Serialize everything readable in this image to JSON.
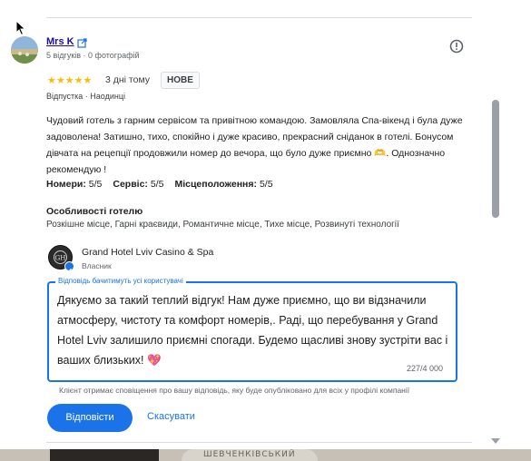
{
  "reviewer": {
    "name": "Mrs K",
    "meta": "5 відгуків · 0 фотографій"
  },
  "review": {
    "stars": "★★★★★",
    "time_ago": "3 дні тому",
    "badge": "НОВЕ",
    "trip": "Відпустка · Наодинці",
    "text": "Чудовий готель з гарним сервісом та привітною командою. Замовляла Спа-вікенд і була дуже задоволена! Затишно, тихо, спокійно і дуже красиво, прекрасний сніданок в готелі. Бонусом дівчата на рецепції продовжили номер до вечора, що було дуже приємно 🫶. Однозначно рекомендую !",
    "ratings": {
      "rooms_label": "Номери:",
      "rooms_value": "5/5",
      "service_label": "Сервіс:",
      "service_value": "5/5",
      "location_label": "Місцеположення:",
      "location_value": "5/5"
    },
    "features_title": "Особливості готелю",
    "features": "Розкішне місце, Гарні краєвиди, Романтичне місце, Тихе місце, Розвинуті технології"
  },
  "owner": {
    "name": "Grand Hotel Lviv Casino & Spa",
    "role": "Власник"
  },
  "reply": {
    "legend": "Відповідь бачитимуть усі користувачі",
    "text": "Дякуємо за такий теплий відгук! Нам дуже приємно, що ви відзначили атмосферу, чистоту та комфорт номерів,. Раді, що перебування у Grand Hotel Lviv залишило приємні спогади. Будемо щасливі знову зустріти вас і ваших близьких! 💖",
    "char_count": "227/4 000",
    "notice": "Клієнт отримає сповіщення про вашу відповідь, яку буде опубліковано для всіх у профілі компанії"
  },
  "actions": {
    "reply_label": "Відповісти",
    "cancel_label": "Скасувати"
  },
  "background": {
    "sign_text": "ШЕВЧЕНКІВСЬКИЙ"
  },
  "colors": {
    "accent": "#1a73e8",
    "star": "#fbbc04"
  }
}
